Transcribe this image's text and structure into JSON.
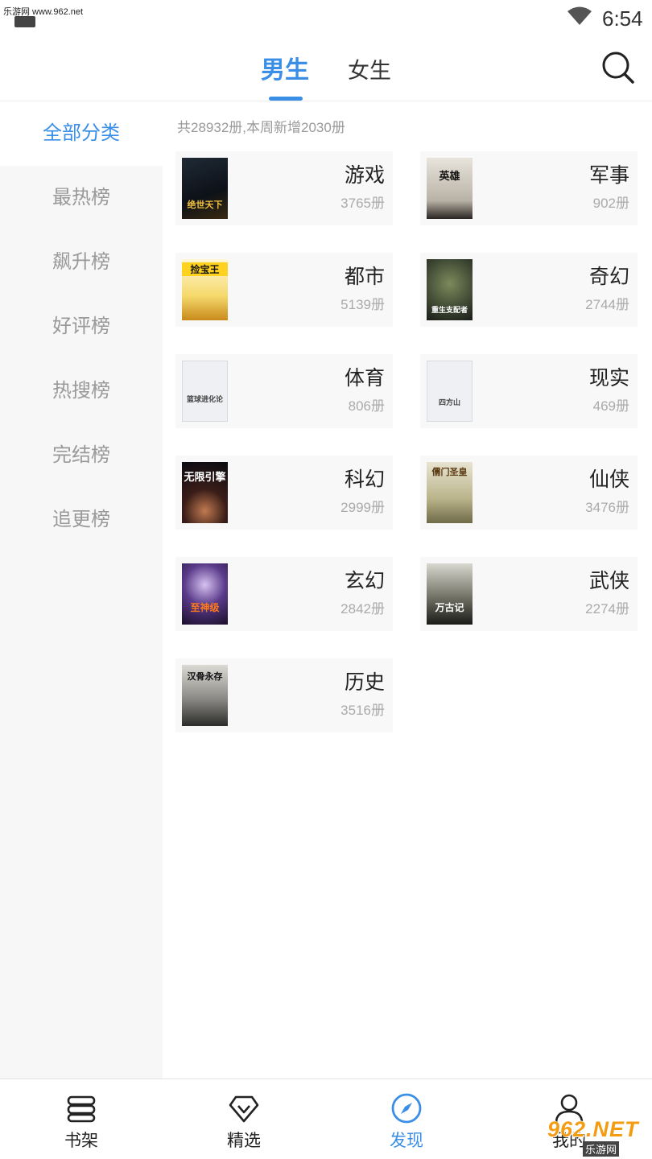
{
  "status_bar": {
    "watermark": "乐游网 www.962.net",
    "time": "6:54"
  },
  "header": {
    "tabs": [
      {
        "label": "男生",
        "active": true
      },
      {
        "label": "女生",
        "active": false
      }
    ],
    "accent_color": "#3a8ee6"
  },
  "sidebar": {
    "items": [
      {
        "label": "全部分类",
        "active": true
      },
      {
        "label": "最热榜",
        "active": false
      },
      {
        "label": "飙升榜",
        "active": false
      },
      {
        "label": "好评榜",
        "active": false
      },
      {
        "label": "热搜榜",
        "active": false
      },
      {
        "label": "完结榜",
        "active": false
      },
      {
        "label": "追更榜",
        "active": false
      }
    ]
  },
  "main": {
    "summary": "共28932册,本周新增2030册",
    "categories": [
      {
        "title": "游戏",
        "count": "3765册",
        "cover_text": "绝世天下"
      },
      {
        "title": "军事",
        "count": "902册",
        "cover_text": "英雄"
      },
      {
        "title": "都市",
        "count": "5139册",
        "cover_text": "捡宝王"
      },
      {
        "title": "奇幻",
        "count": "2744册",
        "cover_text": "重生支配者"
      },
      {
        "title": "体育",
        "count": "806册",
        "cover_text": "篮球进化论"
      },
      {
        "title": "现实",
        "count": "469册",
        "cover_text": "四方山"
      },
      {
        "title": "科幻",
        "count": "2999册",
        "cover_text": "无限引擎"
      },
      {
        "title": "仙侠",
        "count": "3476册",
        "cover_text": "儒门圣皇"
      },
      {
        "title": "玄幻",
        "count": "2842册",
        "cover_text": "至神级"
      },
      {
        "title": "武侠",
        "count": "2274册",
        "cover_text": "万古记"
      },
      {
        "title": "历史",
        "count": "3516册",
        "cover_text": "汉骨永存"
      }
    ]
  },
  "bottom_nav": {
    "items": [
      {
        "label": "书架",
        "icon": "bookshelf-icon",
        "active": false
      },
      {
        "label": "精选",
        "icon": "diamond-icon",
        "active": false
      },
      {
        "label": "发现",
        "icon": "compass-icon",
        "active": true
      },
      {
        "label": "我的",
        "icon": "user-icon",
        "active": false
      }
    ]
  },
  "watermark_logo": {
    "main": "962.NET",
    "sub": "乐游网"
  }
}
